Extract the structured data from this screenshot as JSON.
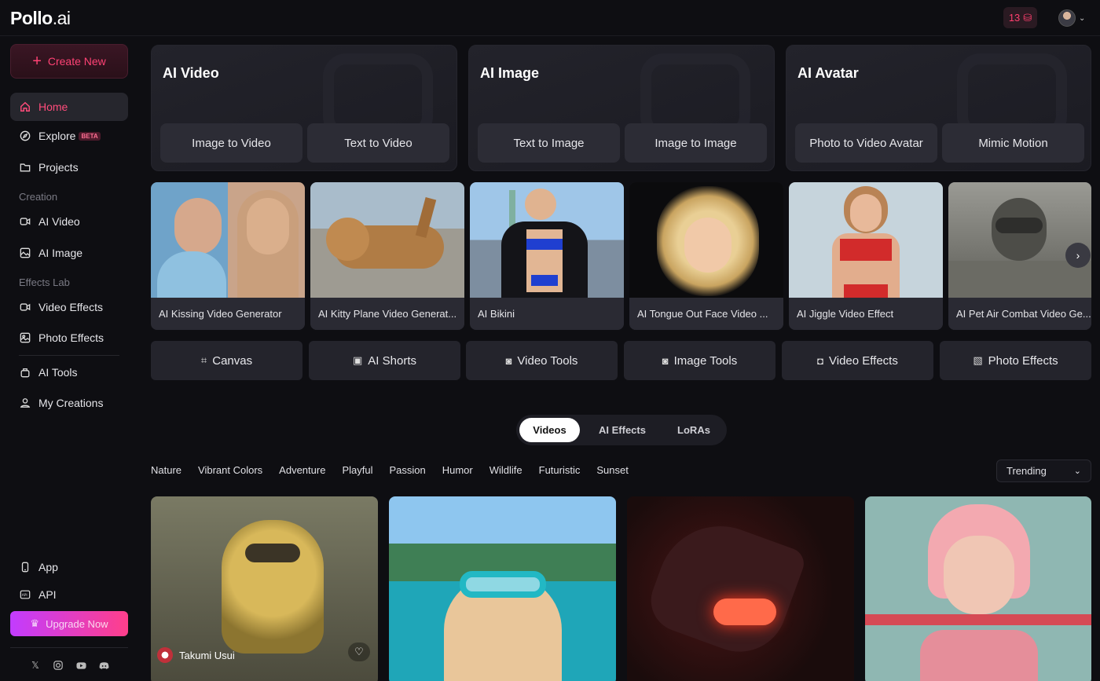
{
  "app": {
    "logo_main": "Pollo",
    "logo_suffix": ".ai",
    "credits": "13"
  },
  "sidebar": {
    "create_label": "Create New",
    "home": "Home",
    "explore": "Explore",
    "explore_badge": "BETA",
    "projects": "Projects",
    "creation_label": "Creation",
    "ai_video": "AI Video",
    "ai_image": "AI Image",
    "effects_label": "Effects Lab",
    "video_effects": "Video Effects",
    "photo_effects": "Photo Effects",
    "ai_tools": "AI Tools",
    "my_creations": "My Creations",
    "app": "App",
    "api": "API",
    "upgrade": "Upgrade Now"
  },
  "features": [
    {
      "title": "AI Video",
      "buttons": [
        "Image to Video",
        "Text to Video"
      ]
    },
    {
      "title": "AI Image",
      "buttons": [
        "Text to Image",
        "Image to Image"
      ]
    },
    {
      "title": "AI Avatar",
      "buttons": [
        "Photo to Video Avatar",
        "Mimic Motion"
      ]
    }
  ],
  "templates": [
    "AI Kissing Video Generator",
    "AI Kitty Plane Video Generat...",
    "AI Bikini",
    "AI Tongue Out Face Video ...",
    "AI Jiggle Video Effect",
    "AI Pet Air Combat Video Ge..."
  ],
  "tools": [
    "Canvas",
    "AI Shorts",
    "Video Tools",
    "Image Tools",
    "Video Effects",
    "Photo Effects"
  ],
  "tabs": [
    "Videos",
    "AI Effects",
    "LoRAs"
  ],
  "filters": [
    "Nature",
    "Vibrant Colors",
    "Adventure",
    "Playful",
    "Passion",
    "Humor",
    "Wildlife",
    "Futuristic",
    "Sunset"
  ],
  "sort": "Trending",
  "gallery": {
    "author": "Takumi Usui"
  },
  "colors": {
    "accent": "#ff4274",
    "bg": "#0e0e12",
    "card": "#24242c"
  }
}
